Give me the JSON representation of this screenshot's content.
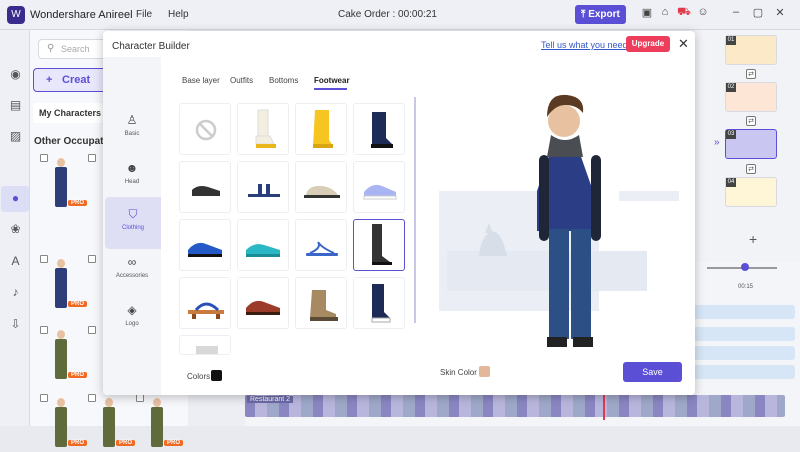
{
  "app": {
    "name": "Wondershare Anireel",
    "logo": "W"
  },
  "menu": {
    "file": "File",
    "help": "Help"
  },
  "project": {
    "title": "Cake Order : 00:00:21"
  },
  "toolbar": {
    "export_label": "Export",
    "icons": [
      "save-icon",
      "home-icon",
      "cart-icon",
      "user-icon",
      "minimize-icon",
      "maximize-icon",
      "close-icon"
    ]
  },
  "library": {
    "search_placeholder": "Search",
    "create_label": "Creat",
    "my_characters": "My Characters",
    "other_occupation": "Other Occupation",
    "pro_badge": "PRO"
  },
  "timeline": {
    "time_marker": "00:15",
    "film_label": "Restaurant 2"
  },
  "scenes": [
    "01",
    "02",
    "03",
    "04"
  ],
  "modal": {
    "title": "Character Builder",
    "feedback_link": "Tell us what you need",
    "upgrade_label": "Upgrade",
    "side_nav": [
      {
        "label": "Basic",
        "icon": "person-icon"
      },
      {
        "label": "Head",
        "icon": "head-icon"
      },
      {
        "label": "Clothing",
        "icon": "shirt-icon"
      },
      {
        "label": "Accessories",
        "icon": "glasses-icon"
      },
      {
        "label": "Logo",
        "icon": "logo-icon"
      }
    ],
    "active_side": "Clothing",
    "tabs": [
      "Base layer",
      "Outfits",
      "Bottoms",
      "Footwear"
    ],
    "active_tab": "Footwear",
    "footwear_items": [
      "none",
      "white-boot-yellow-sole",
      "yellow-rain-boot",
      "navy-boot",
      "black-loafer",
      "navy-slide",
      "beige-slipper",
      "lavender-sneaker",
      "blue-cleat",
      "teal-sneaker",
      "blue-flip-flop",
      "black-tall-boot",
      "geta-sandal",
      "red-brown-shoe",
      "tan-hiking-boot",
      "navy-high-top",
      "grey-item"
    ],
    "selected_item": "black-tall-boot",
    "colors_label": "Colors",
    "colors_swatch": "#111111",
    "skin_label": "Skin Color",
    "skin_swatch": "#e3b89a",
    "save_label": "Save"
  },
  "accent_color": "#5b4fd6"
}
